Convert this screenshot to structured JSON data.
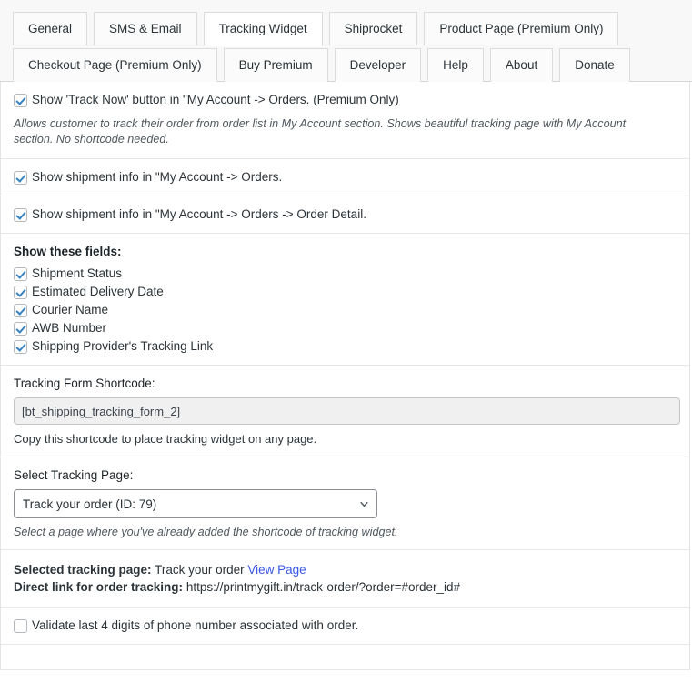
{
  "tabs": {
    "row1": [
      {
        "label": "General",
        "active": false
      },
      {
        "label": "SMS & Email",
        "active": false
      },
      {
        "label": "Tracking Widget",
        "active": true
      },
      {
        "label": "Shiprocket",
        "active": false
      },
      {
        "label": "Product Page (Premium Only)",
        "active": false
      }
    ],
    "row2": [
      {
        "label": "Checkout Page (Premium Only)",
        "active": false
      },
      {
        "label": "Buy Premium",
        "active": false
      },
      {
        "label": "Developer",
        "active": false
      },
      {
        "label": "Help",
        "active": false
      },
      {
        "label": "About",
        "active": false
      },
      {
        "label": "Donate",
        "active": false
      }
    ]
  },
  "sections": {
    "track_now": {
      "checkbox_label": "Show 'Track Now' button in \"My Account -> Orders. (Premium Only)",
      "checked": true,
      "description": "Allows customer to track their order from order list in My Account section. Shows beautiful tracking page with My Account section. No shortcode needed."
    },
    "shipment_orders": {
      "checkbox_label": "Show shipment info in \"My Account -> Orders.",
      "checked": true
    },
    "shipment_order_detail": {
      "checkbox_label": "Show shipment info in \"My Account -> Orders -> Order Detail.",
      "checked": true
    },
    "fields": {
      "title": "Show these fields:",
      "items": [
        {
          "label": "Shipment Status",
          "checked": true
        },
        {
          "label": "Estimated Delivery Date",
          "checked": true
        },
        {
          "label": "Courier Name",
          "checked": true
        },
        {
          "label": "AWB Number",
          "checked": true
        },
        {
          "label": "Shipping Provider's Tracking Link",
          "checked": true
        }
      ]
    },
    "shortcode": {
      "label": "Tracking Form Shortcode:",
      "value": "[bt_shipping_tracking_form_2]",
      "hint": "Copy this shortcode to place tracking widget on any page."
    },
    "tracking_page": {
      "label": "Select Tracking Page:",
      "selected": "Track your order (ID: 79)",
      "hint": "Select a page where you've already added the shortcode of tracking widget."
    },
    "selected_info": {
      "selected_label": "Selected tracking page:",
      "selected_value": "Track your order",
      "view_page_link": "View Page",
      "direct_link_label": "Direct link for order tracking:",
      "direct_link_value": "https://printmygift.in/track-order/?order=#order_id#"
    },
    "validate_phone": {
      "checkbox_label": "Validate last 4 digits of phone number associated with order.",
      "checked": false
    }
  },
  "colors": {
    "accent": "#3582c4",
    "link": "#3858e9",
    "tab_bar_bg": "#f8f8f8",
    "border": "#dcdcde"
  }
}
